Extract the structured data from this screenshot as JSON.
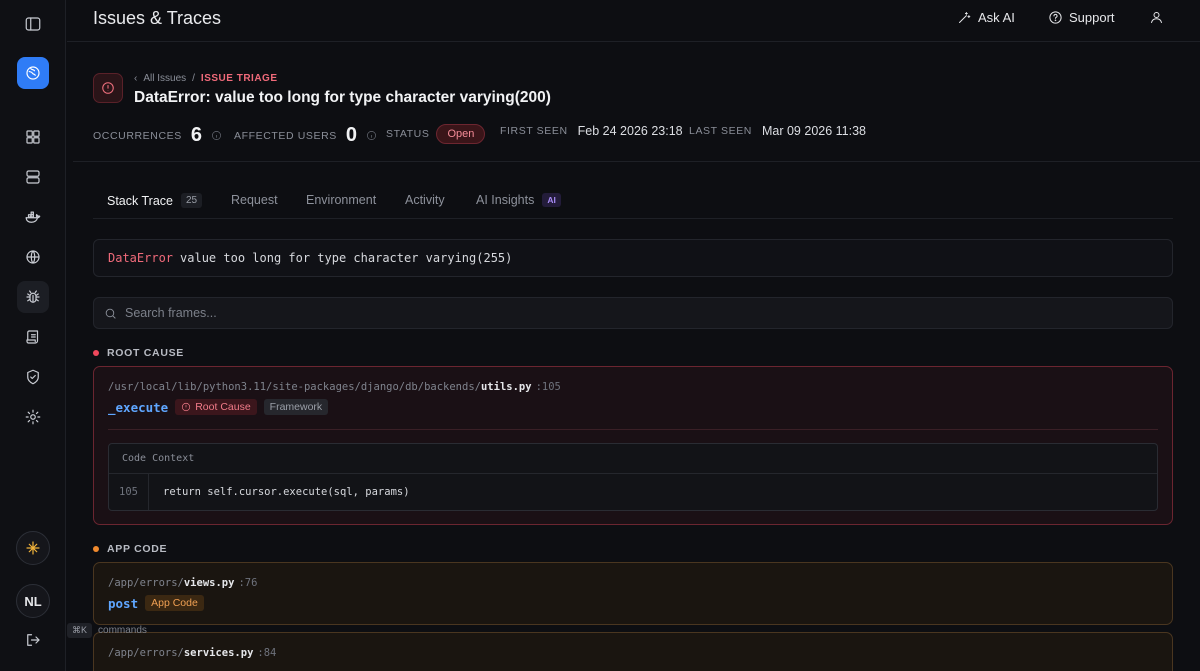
{
  "topbar": {
    "title": "Issues & Traces",
    "ask_ai": "Ask AI",
    "support": "Support"
  },
  "breadcrumb": {
    "parent": "All Issues",
    "separator": "/",
    "current": "ISSUE TRIAGE"
  },
  "issue": {
    "title": "DataError: value too long for type character varying(200)"
  },
  "meta": {
    "occurrences_label": "OCCURRENCES",
    "occurrences": "6",
    "affected_label": "AFFECTED USERS",
    "affected": "0",
    "status_label": "STATUS",
    "status": "Open",
    "first_seen_label": "FIRST SEEN",
    "first_seen": "Feb 24 2026 23:18",
    "last_seen_label": "LAST SEEN",
    "last_seen": "Mar 09 2026 11:38"
  },
  "tabs": [
    {
      "label": "Stack Trace",
      "count": "25"
    },
    {
      "label": "Request"
    },
    {
      "label": "Environment"
    },
    {
      "label": "Activity"
    },
    {
      "label": "AI Insights",
      "badge": "AI"
    }
  ],
  "error": {
    "type": "DataError",
    "message": "value too long for type character varying(255)"
  },
  "search": {
    "placeholder": "Search frames..."
  },
  "sections": {
    "root_cause": "ROOT CAUSE",
    "app_code": "APP CODE"
  },
  "frames": [
    {
      "path_dir": "/usr/local/lib/python3.11/site-packages/django/db/backends/",
      "file": "utils.py",
      "line": ":105",
      "function": "_execute",
      "tags": [
        "Root Cause",
        "Framework"
      ],
      "code_context_label": "Code Context",
      "code_line_no": "105",
      "code_src": "return self.cursor.execute(sql, params)"
    },
    {
      "path_dir": "/app/errors/",
      "file": "views.py",
      "line": ":76",
      "function": "post",
      "tags": [
        "App Code"
      ]
    },
    {
      "path_dir": "/app/errors/",
      "file": "services.py",
      "line": ":84"
    }
  ],
  "sidebar": {
    "avatar_initials": "NL"
  },
  "hint": {
    "kbd": "⌘K",
    "label": "commands"
  },
  "colors": {
    "accent": "#2f7cf6",
    "error": "#f06a7a",
    "app_code": "#f0a053"
  }
}
